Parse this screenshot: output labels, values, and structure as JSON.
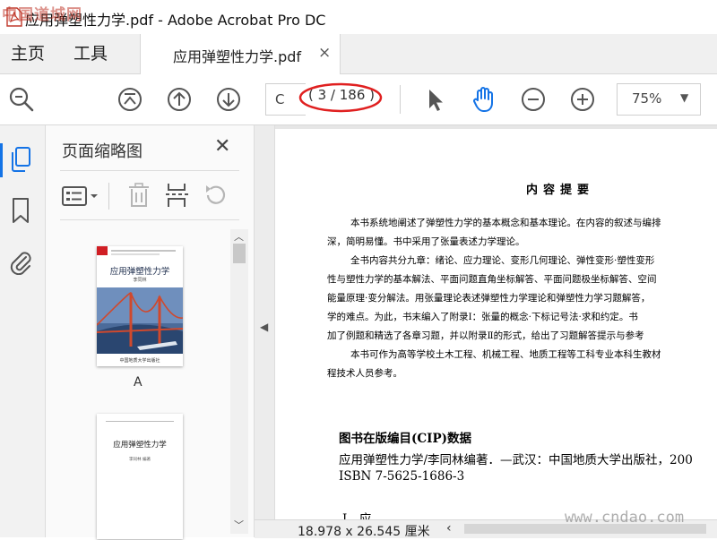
{
  "window": {
    "title": "应用弹塑性力学.pdf - Adobe Acrobat Pro DC",
    "watermark_top": "中国道城网",
    "watermark_bottom": "www.cndao.com"
  },
  "tabs": {
    "home": "主页",
    "tools": "工具",
    "document": "应用弹塑性力学.pdf",
    "close_glyph": "×"
  },
  "toolbar": {
    "page_field_value": "C",
    "page_indicator": "( 3 / 186 )",
    "zoom": "75%",
    "icons": [
      "search-zoom-icon",
      "first-page-icon",
      "prev-page-icon",
      "next-page-icon",
      "select-arrow-icon",
      "hand-tool-icon",
      "zoom-out-icon",
      "zoom-in-icon",
      "dropdown-caret-icon"
    ],
    "accent_color": "#1473e6",
    "annotation_color": "#e02020"
  },
  "left_rail": {
    "icons": [
      "page-thumbnails-icon",
      "bookmarks-icon",
      "attachments-icon"
    ]
  },
  "thumbnails_panel": {
    "title": "页面缩略图",
    "close_glyph": "✕",
    "tool_icons": [
      "thumbnail-options-icon",
      "delete-page-icon",
      "insert-page-icon",
      "rotate-page-icon"
    ],
    "pages": [
      {
        "label": "A",
        "cover_title": "应用弹塑性力学",
        "cover_author": "李同林",
        "cover_publisher": "中国地质大学出版社"
      },
      {
        "label": "",
        "title": "应用弹塑性力学",
        "author": "李同林  编著"
      }
    ]
  },
  "document": {
    "heading": "内容提要",
    "paragraphs": [
      "本书系统地阐述了弹塑性力学的基本概念和基本理论。在内容的叙述与编排",
      "深，简明易懂。书中采用了张量表述力学理论。",
      "全书内容共分九章：绪论、应力理论、变形几何理论、弹性变形·塑性变形",
      "性与塑性力学的基本解法、平面问题直角坐标解答、平面问题极坐标解答、空间",
      "能量原理·变分解法。用张量理论表述弹塑性力学理论和弹塑性力学习题解答，",
      "学的难点。为此，书末编入了附录Ⅰ：张量的概念·下标记号法·求和约定。书",
      "加了例题和精选了各章习题，并以附录Ⅱ的形式，给出了习题解答提示与参考",
      "本书可作为高等学校土木工程、机械工程、地质工程等工科专业本科生教材",
      "程技术人员参考。"
    ],
    "cip_heading": "图书在版编目(CIP)数据",
    "cip_line": "应用弹塑性力学/李同林编著．—武汉：中国地质大学出版社，200",
    "isbn": "ISBN 7-5625-1686-3",
    "cip_item": "Ⅰ．应…"
  },
  "status": {
    "page_size": "18.978 x 26.545 厘米"
  }
}
